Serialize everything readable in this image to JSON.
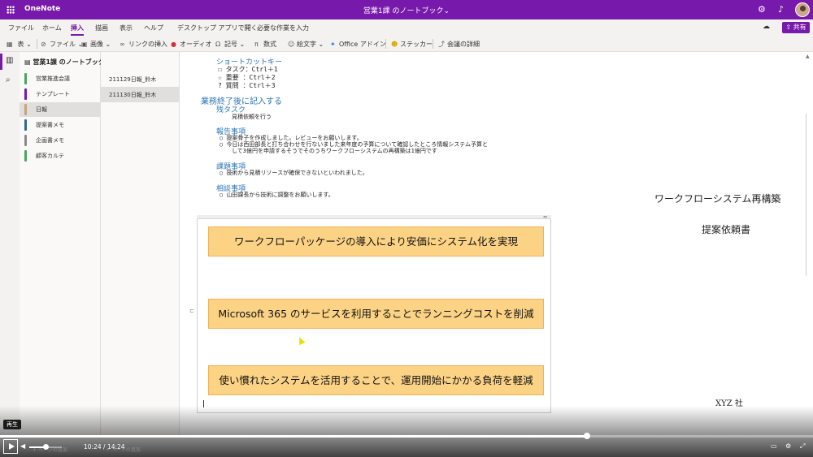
{
  "titlebar": {
    "app_name": "OneNote",
    "doc_title": "営業1課 のノートブック⌄"
  },
  "ribbon": {
    "tabs": [
      {
        "label": "ファイル"
      },
      {
        "label": "ホーム"
      },
      {
        "label": "挿入"
      },
      {
        "label": "描画"
      },
      {
        "label": "表示"
      },
      {
        "label": "ヘルプ"
      }
    ],
    "active_tab": "挿入",
    "open_desktop": "デスクトップ アプリで開く",
    "tell_me": "必要な作業を入力",
    "share_label": "共有"
  },
  "toolbar": {
    "items": [
      {
        "label": "表 ⌄",
        "icon": "table-icon"
      },
      {
        "label": "ファイル ⌄",
        "icon": "attach-icon"
      },
      {
        "label": "画像 ⌄",
        "icon": "picture-icon"
      },
      {
        "label": "リンクの挿入",
        "icon": "link-icon"
      },
      {
        "label": "オーディオ",
        "icon": "record-icon"
      },
      {
        "label": "記号 ⌄",
        "icon": "omega-icon"
      },
      {
        "label": "数式",
        "icon": "pi-icon"
      },
      {
        "label": "絵文字 ⌄",
        "icon": "emoji-icon"
      },
      {
        "label": "Office アドイン",
        "icon": "addin-icon"
      },
      {
        "label": "ステッカー",
        "icon": "sticker-icon"
      },
      {
        "label": "会議の詳細",
        "icon": "meeting-icon"
      }
    ]
  },
  "notebook": {
    "title": "営業1課 のノートブック",
    "sections": [
      {
        "label": "営業推進会議",
        "color": "#4aa564"
      },
      {
        "label": "テンプレート",
        "color": "#7719aa"
      },
      {
        "label": "日報",
        "color": "#c7a27c"
      },
      {
        "label": "提案書メモ",
        "color": "#2b6d8e"
      },
      {
        "label": "企画書メモ",
        "color": "#8a8a8a"
      },
      {
        "label": "顧客カルテ",
        "color": "#4aa564"
      }
    ],
    "selected_section": "日報",
    "pages": [
      {
        "label": "211129日報_鈴木"
      },
      {
        "label": "211130日報_鈴木"
      }
    ],
    "selected_page": "211130日報_鈴木"
  },
  "note": {
    "shortcut_heading": "ショートカットキー",
    "shortcuts": [
      {
        "symbol": "☐",
        "text": "タスク：Ctrl＋1"
      },
      {
        "symbol": "☆",
        "text": "重要  ：Ctrl＋2"
      },
      {
        "symbol": "?",
        "text": "質問  ：Ctrl＋3"
      }
    ],
    "after_work_heading": "業務終了後に記入する",
    "remaining_task_heading": "残タスク",
    "remaining_task_text": "見積依頼を行う",
    "report_heading": "報告事項",
    "report_items": [
      "提案骨子を作成しました。レビューをお願いします。",
      "今日は西田部長と打ち合わせを行ないました来年度の予算について確認したところ情報システム予算と",
      "して3億円を申請するそうでそのうちワークフローシステムの再構築は1億円です"
    ],
    "issue_heading": "課題事項",
    "issue_items": [
      "技術から見積リソースが確保できないといわれました。"
    ],
    "consult_heading": "相談事項",
    "consult_items": [
      "山田課長から技術に調整をお願いします。"
    ]
  },
  "slide": {
    "boxes": [
      "ワークフローパッケージの導入により安価にシステム化を実現",
      "Microsoft 365 のサービスを利用することでランニングコストを削減",
      "使い慣れたシステムを活用することで、運用開始にかかる負荷を軽減"
    ],
    "box_color": "#fcd385"
  },
  "document": {
    "title_line1": "ワークフローシステム再構築",
    "title_line2": "提案依頼書",
    "company": "XYZ 社"
  },
  "player": {
    "tooltip": "再生",
    "current_time": "10:24",
    "separator": "/",
    "total_time": "14:24",
    "progress": 0.7222,
    "volume": 0.5
  }
}
